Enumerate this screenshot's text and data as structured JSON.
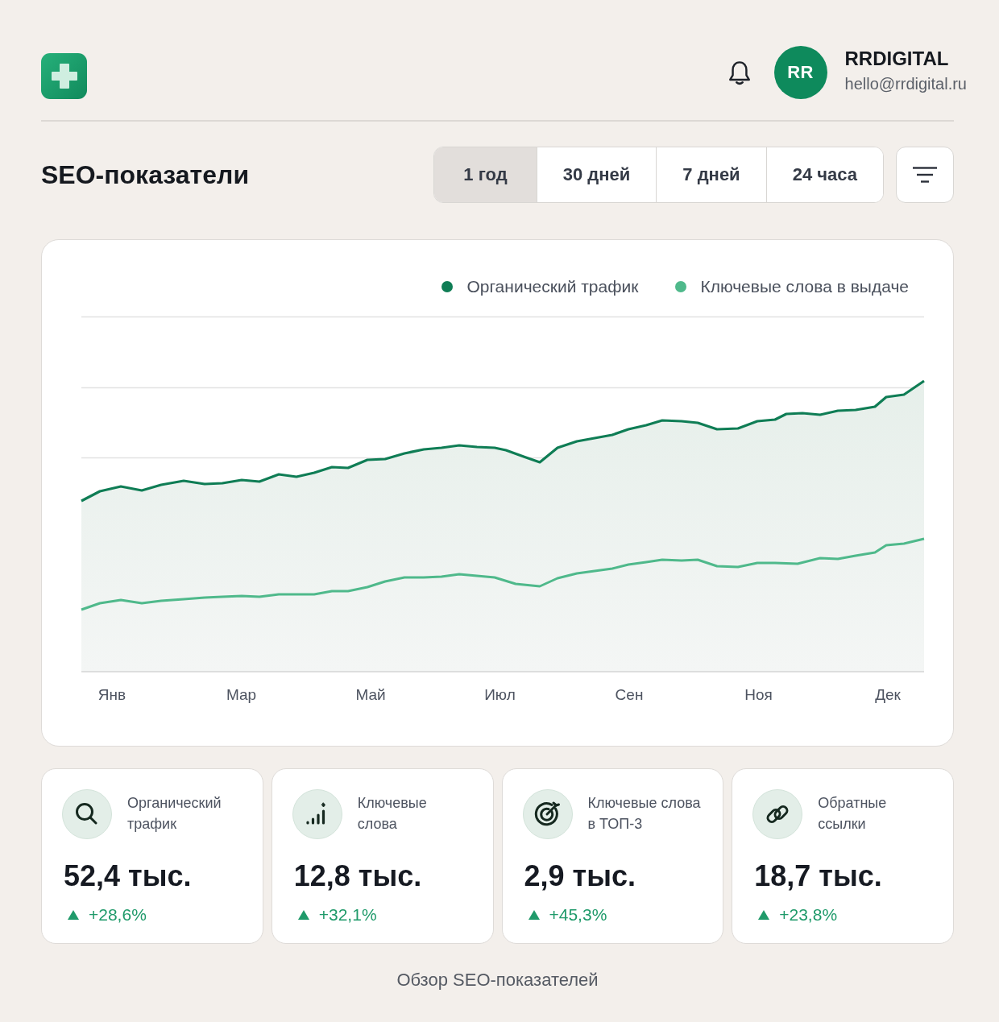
{
  "header": {
    "user": {
      "initials": "RR",
      "name": "RRDIGITAL",
      "email": "hello@rrdigital.ru"
    }
  },
  "title": "SEO-показатели",
  "periods": [
    {
      "label": "1 год",
      "selected": true
    },
    {
      "label": "30 дней",
      "selected": false
    },
    {
      "label": "7 дней",
      "selected": false
    },
    {
      "label": "24 часа",
      "selected": false
    }
  ],
  "chart": {
    "legend": [
      {
        "label": "Органический трафик",
        "color": "#0f7d55"
      },
      {
        "label": "Ключевые слова в выдаче",
        "color": "#4fb98b"
      }
    ],
    "x_labels": [
      "Янв",
      "Мар",
      "Май",
      "Июл",
      "Сен",
      "Ноя",
      "Дек"
    ]
  },
  "stats": [
    {
      "label": "Органический\nтрафик",
      "value": "52,4 тыс.",
      "change": "+28,6%",
      "increase": true
    },
    {
      "label": "Ключевые\nслова",
      "value": "12,8 тыс.",
      "change": "+32,1%",
      "increase": true
    },
    {
      "label": "Ключевые слова\nв ТОП-3",
      "value": "2,9 тыс.",
      "change": "+45,3%",
      "increase": true
    },
    {
      "label": "Обратные\nссылки",
      "value": "18,7 тыс.",
      "change": "+23,8%",
      "increase": true
    }
  ],
  "caption": "Обзор SEO-показателей"
}
